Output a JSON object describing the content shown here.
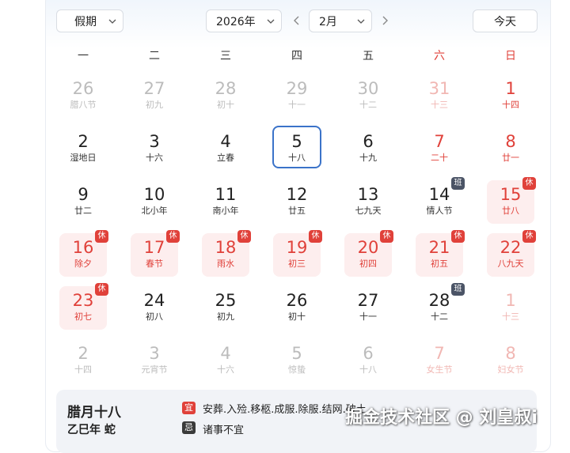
{
  "controls": {
    "holiday_select": "假期",
    "year_select": "2026年",
    "month_select": "2月",
    "today_button": "今天"
  },
  "weekdays": [
    "一",
    "二",
    "三",
    "四",
    "五",
    "六",
    "日"
  ],
  "weeks": [
    [
      {
        "day": "26",
        "sub": "腊八节",
        "style": "dim"
      },
      {
        "day": "27",
        "sub": "初九",
        "style": "dim"
      },
      {
        "day": "28",
        "sub": "初十",
        "style": "dim"
      },
      {
        "day": "29",
        "sub": "十一",
        "style": "dim"
      },
      {
        "day": "30",
        "sub": "十二",
        "style": "dim"
      },
      {
        "day": "31",
        "sub": "十三",
        "style": "dimred"
      },
      {
        "day": "1",
        "sub": "十四",
        "style": "red"
      }
    ],
    [
      {
        "day": "2",
        "sub": "湿地日",
        "style": "normal"
      },
      {
        "day": "3",
        "sub": "十六",
        "style": "normal"
      },
      {
        "day": "4",
        "sub": "立春",
        "style": "normal"
      },
      {
        "day": "5",
        "sub": "十八",
        "style": "normal",
        "today": true
      },
      {
        "day": "6",
        "sub": "十九",
        "style": "normal"
      },
      {
        "day": "7",
        "sub": "二十",
        "style": "red"
      },
      {
        "day": "8",
        "sub": "廿一",
        "style": "red"
      }
    ],
    [
      {
        "day": "9",
        "sub": "廿二",
        "style": "normal"
      },
      {
        "day": "10",
        "sub": "北小年",
        "style": "normal"
      },
      {
        "day": "11",
        "sub": "南小年",
        "style": "normal"
      },
      {
        "day": "12",
        "sub": "廿五",
        "style": "normal"
      },
      {
        "day": "13",
        "sub": "七九天",
        "style": "normal"
      },
      {
        "day": "14",
        "sub": "情人节",
        "style": "normal",
        "badge": "班"
      },
      {
        "day": "15",
        "sub": "廿八",
        "style": "red",
        "holiday": true,
        "badge": "休"
      }
    ],
    [
      {
        "day": "16",
        "sub": "除夕",
        "style": "red",
        "holiday": true,
        "badge": "休"
      },
      {
        "day": "17",
        "sub": "春节",
        "style": "red",
        "holiday": true,
        "badge": "休"
      },
      {
        "day": "18",
        "sub": "雨水",
        "style": "red",
        "holiday": true,
        "badge": "休"
      },
      {
        "day": "19",
        "sub": "初三",
        "style": "red",
        "holiday": true,
        "badge": "休"
      },
      {
        "day": "20",
        "sub": "初四",
        "style": "red",
        "holiday": true,
        "badge": "休"
      },
      {
        "day": "21",
        "sub": "初五",
        "style": "red",
        "holiday": true,
        "badge": "休"
      },
      {
        "day": "22",
        "sub": "八九天",
        "style": "red",
        "holiday": true,
        "badge": "休"
      }
    ],
    [
      {
        "day": "23",
        "sub": "初七",
        "style": "red",
        "holiday": true,
        "badge": "休"
      },
      {
        "day": "24",
        "sub": "初八",
        "style": "normal"
      },
      {
        "day": "25",
        "sub": "初九",
        "style": "normal"
      },
      {
        "day": "26",
        "sub": "初十",
        "style": "normal"
      },
      {
        "day": "27",
        "sub": "十一",
        "style": "normal"
      },
      {
        "day": "28",
        "sub": "十二",
        "style": "normal",
        "badge": "班"
      },
      {
        "day": "1",
        "sub": "十三",
        "style": "dimred"
      }
    ],
    [
      {
        "day": "2",
        "sub": "十四",
        "style": "dim"
      },
      {
        "day": "3",
        "sub": "元宵节",
        "style": "dim"
      },
      {
        "day": "4",
        "sub": "十六",
        "style": "dim"
      },
      {
        "day": "5",
        "sub": "惊蛰",
        "style": "dim"
      },
      {
        "day": "6",
        "sub": "十八",
        "style": "dim"
      },
      {
        "day": "7",
        "sub": "女生节",
        "style": "dimred"
      },
      {
        "day": "8",
        "sub": "妇女节",
        "style": "dimred"
      }
    ]
  ],
  "info": {
    "lunar_date": "腊月十八",
    "ganzhi": "乙巳年 蛇",
    "yi_label": "宜",
    "yi_text": "安葬.入殓.移柩.成服.除服.结网.破土",
    "ji_label": "忌",
    "ji_text": "诸事不宜"
  },
  "watermark": "掘金技术社区 @ 刘皇叔i",
  "colors": {
    "holiday_red": "#e0413a",
    "today_border": "#3b73c9",
    "work_badge": "#4b5466"
  }
}
